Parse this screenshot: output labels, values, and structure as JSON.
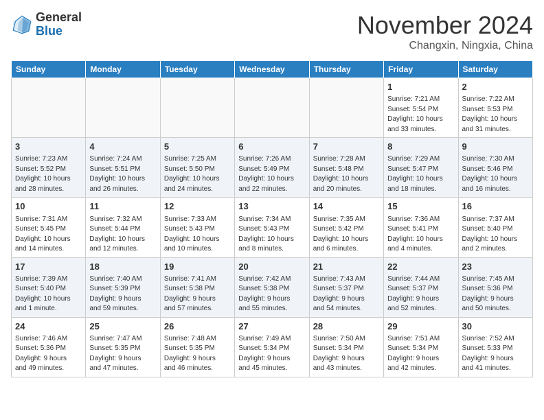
{
  "header": {
    "logo_line1": "General",
    "logo_line2": "Blue",
    "month": "November 2024",
    "location": "Changxin, Ningxia, China"
  },
  "days_of_week": [
    "Sunday",
    "Monday",
    "Tuesday",
    "Wednesday",
    "Thursday",
    "Friday",
    "Saturday"
  ],
  "weeks": [
    [
      {
        "day": "",
        "info": ""
      },
      {
        "day": "",
        "info": ""
      },
      {
        "day": "",
        "info": ""
      },
      {
        "day": "",
        "info": ""
      },
      {
        "day": "",
        "info": ""
      },
      {
        "day": "1",
        "info": "Sunrise: 7:21 AM\nSunset: 5:54 PM\nDaylight: 10 hours\nand 33 minutes."
      },
      {
        "day": "2",
        "info": "Sunrise: 7:22 AM\nSunset: 5:53 PM\nDaylight: 10 hours\nand 31 minutes."
      }
    ],
    [
      {
        "day": "3",
        "info": "Sunrise: 7:23 AM\nSunset: 5:52 PM\nDaylight: 10 hours\nand 28 minutes."
      },
      {
        "day": "4",
        "info": "Sunrise: 7:24 AM\nSunset: 5:51 PM\nDaylight: 10 hours\nand 26 minutes."
      },
      {
        "day": "5",
        "info": "Sunrise: 7:25 AM\nSunset: 5:50 PM\nDaylight: 10 hours\nand 24 minutes."
      },
      {
        "day": "6",
        "info": "Sunrise: 7:26 AM\nSunset: 5:49 PM\nDaylight: 10 hours\nand 22 minutes."
      },
      {
        "day": "7",
        "info": "Sunrise: 7:28 AM\nSunset: 5:48 PM\nDaylight: 10 hours\nand 20 minutes."
      },
      {
        "day": "8",
        "info": "Sunrise: 7:29 AM\nSunset: 5:47 PM\nDaylight: 10 hours\nand 18 minutes."
      },
      {
        "day": "9",
        "info": "Sunrise: 7:30 AM\nSunset: 5:46 PM\nDaylight: 10 hours\nand 16 minutes."
      }
    ],
    [
      {
        "day": "10",
        "info": "Sunrise: 7:31 AM\nSunset: 5:45 PM\nDaylight: 10 hours\nand 14 minutes."
      },
      {
        "day": "11",
        "info": "Sunrise: 7:32 AM\nSunset: 5:44 PM\nDaylight: 10 hours\nand 12 minutes."
      },
      {
        "day": "12",
        "info": "Sunrise: 7:33 AM\nSunset: 5:43 PM\nDaylight: 10 hours\nand 10 minutes."
      },
      {
        "day": "13",
        "info": "Sunrise: 7:34 AM\nSunset: 5:43 PM\nDaylight: 10 hours\nand 8 minutes."
      },
      {
        "day": "14",
        "info": "Sunrise: 7:35 AM\nSunset: 5:42 PM\nDaylight: 10 hours\nand 6 minutes."
      },
      {
        "day": "15",
        "info": "Sunrise: 7:36 AM\nSunset: 5:41 PM\nDaylight: 10 hours\nand 4 minutes."
      },
      {
        "day": "16",
        "info": "Sunrise: 7:37 AM\nSunset: 5:40 PM\nDaylight: 10 hours\nand 2 minutes."
      }
    ],
    [
      {
        "day": "17",
        "info": "Sunrise: 7:39 AM\nSunset: 5:40 PM\nDaylight: 10 hours\nand 1 minute."
      },
      {
        "day": "18",
        "info": "Sunrise: 7:40 AM\nSunset: 5:39 PM\nDaylight: 9 hours\nand 59 minutes."
      },
      {
        "day": "19",
        "info": "Sunrise: 7:41 AM\nSunset: 5:38 PM\nDaylight: 9 hours\nand 57 minutes."
      },
      {
        "day": "20",
        "info": "Sunrise: 7:42 AM\nSunset: 5:38 PM\nDaylight: 9 hours\nand 55 minutes."
      },
      {
        "day": "21",
        "info": "Sunrise: 7:43 AM\nSunset: 5:37 PM\nDaylight: 9 hours\nand 54 minutes."
      },
      {
        "day": "22",
        "info": "Sunrise: 7:44 AM\nSunset: 5:37 PM\nDaylight: 9 hours\nand 52 minutes."
      },
      {
        "day": "23",
        "info": "Sunrise: 7:45 AM\nSunset: 5:36 PM\nDaylight: 9 hours\nand 50 minutes."
      }
    ],
    [
      {
        "day": "24",
        "info": "Sunrise: 7:46 AM\nSunset: 5:36 PM\nDaylight: 9 hours\nand 49 minutes."
      },
      {
        "day": "25",
        "info": "Sunrise: 7:47 AM\nSunset: 5:35 PM\nDaylight: 9 hours\nand 47 minutes."
      },
      {
        "day": "26",
        "info": "Sunrise: 7:48 AM\nSunset: 5:35 PM\nDaylight: 9 hours\nand 46 minutes."
      },
      {
        "day": "27",
        "info": "Sunrise: 7:49 AM\nSunset: 5:34 PM\nDaylight: 9 hours\nand 45 minutes."
      },
      {
        "day": "28",
        "info": "Sunrise: 7:50 AM\nSunset: 5:34 PM\nDaylight: 9 hours\nand 43 minutes."
      },
      {
        "day": "29",
        "info": "Sunrise: 7:51 AM\nSunset: 5:34 PM\nDaylight: 9 hours\nand 42 minutes."
      },
      {
        "day": "30",
        "info": "Sunrise: 7:52 AM\nSunset: 5:33 PM\nDaylight: 9 hours\nand 41 minutes."
      }
    ]
  ]
}
